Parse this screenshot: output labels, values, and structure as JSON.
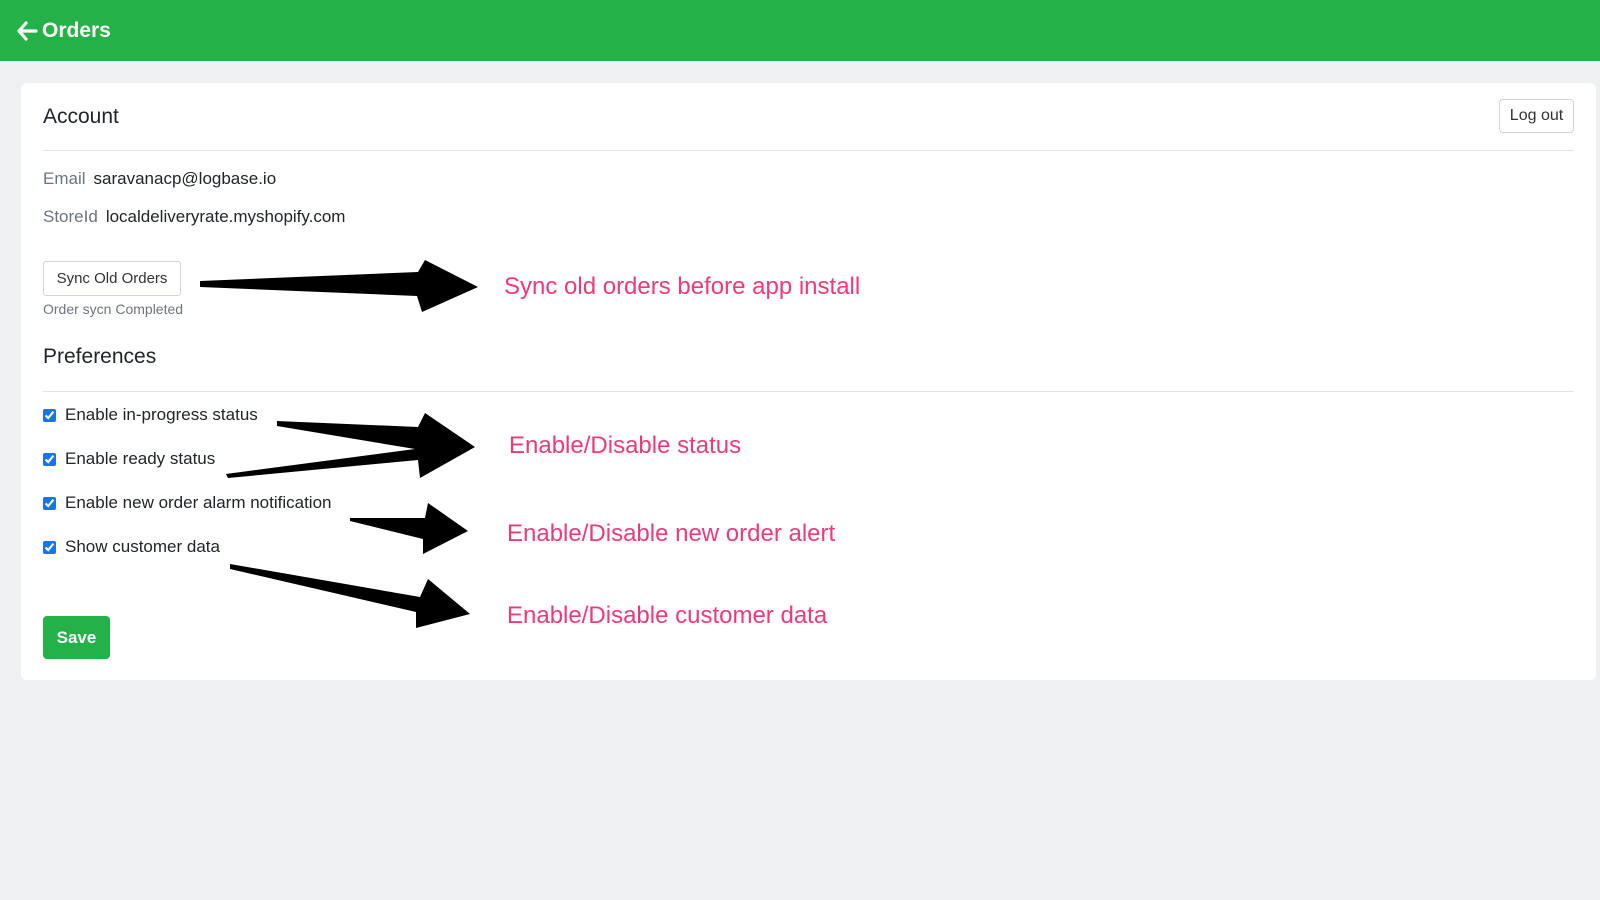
{
  "header": {
    "back_label": "Orders",
    "color": "#24b248"
  },
  "account": {
    "title": "Account",
    "logout_label": "Log out",
    "email_label": "Email",
    "email_value": "saravanacp@logbase.io",
    "store_label": "StoreId",
    "store_value": "localdeliveryrate.myshopify.com",
    "sync_button_label": "Sync Old Orders",
    "sync_status": "Order sycn Completed"
  },
  "preferences": {
    "title": "Preferences",
    "options": [
      {
        "label": "Enable in-progress status",
        "checked": true
      },
      {
        "label": "Enable ready status",
        "checked": true
      },
      {
        "label": "Enable new order alarm notification",
        "checked": true
      },
      {
        "label": "Show customer data",
        "checked": true
      }
    ],
    "save_label": "Save"
  },
  "annotations": {
    "color": "#ee3a7a",
    "sync_note": "Sync old orders before app install",
    "status_note": "Enable/Disable status",
    "alert_note": "Enable/Disable new order alert",
    "customer_note": "Enable/Disable customer data"
  }
}
